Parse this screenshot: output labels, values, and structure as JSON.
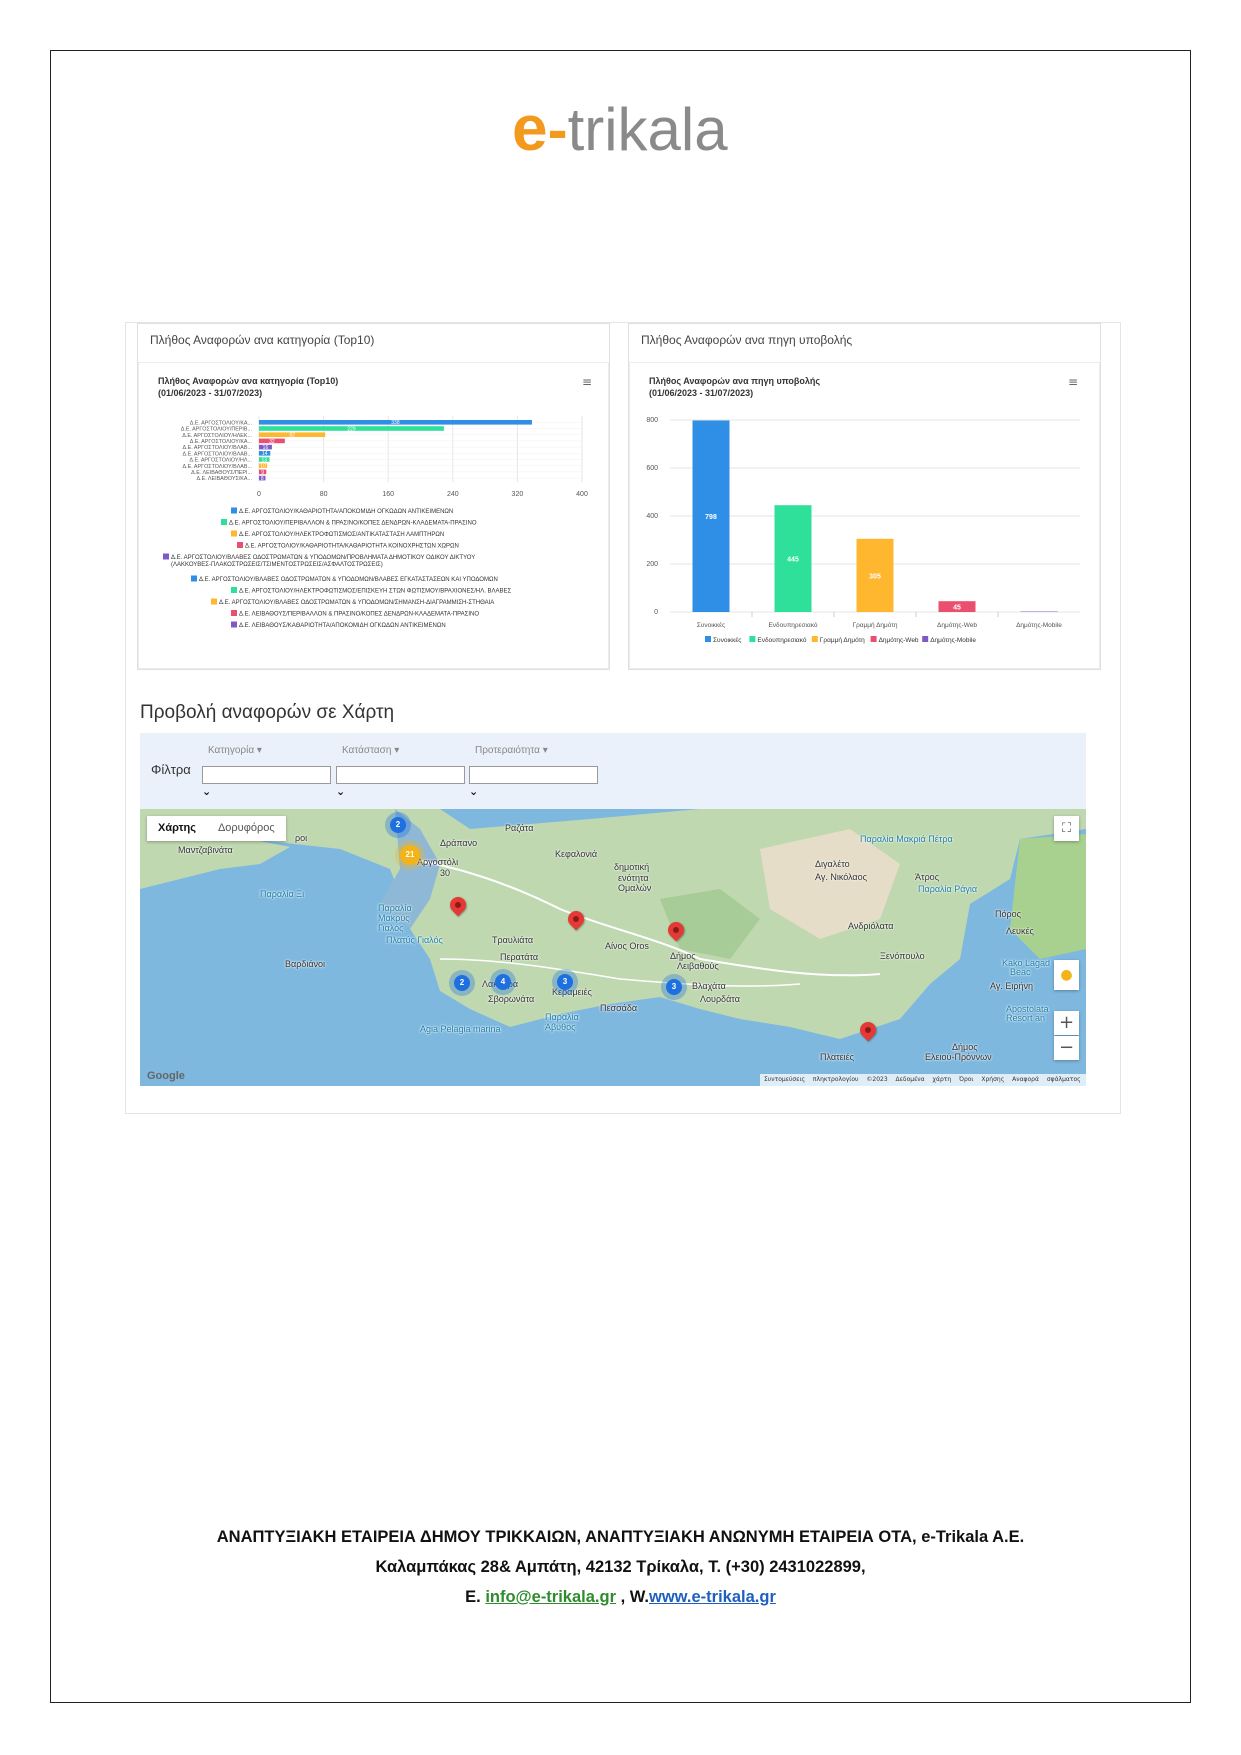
{
  "logo": {
    "e": "e",
    "dash": "-",
    "rest": "trikala"
  },
  "panels": {
    "category": {
      "header": "Πλήθος Αναφορών ανα κατηγορία (Top10)",
      "chart_title": "Πλήθος Αναφορών ανα κατηγορία (Top10)",
      "chart_subtitle": "(01/06/2023 - 31/07/2023)"
    },
    "source": {
      "header": "Πλήθος Αναφορών ανα πηγη υποβολής",
      "chart_title": "Πλήθος Αναφορών ανα πηγη υποβολής",
      "chart_subtitle": "(01/06/2023 - 31/07/2023)"
    }
  },
  "chart_data": [
    {
      "type": "bar",
      "orientation": "horizontal",
      "title": "Πλήθος Αναφορών ανα κατηγορία (Top10)",
      "subtitle": "(01/06/2023 - 31/07/2023)",
      "xlim": [
        0,
        400
      ],
      "xticks": [
        0,
        80,
        160,
        240,
        320,
        400
      ],
      "grid": true,
      "legend": "bottom",
      "categories": [
        "Δ.Ε. ΑΡΓΟΣΤΟΛΙΟΥ/ΚΑ...",
        "Δ.Ε. ΑΡΓΟΣΤΟΛΙΟΥ/ΠΕΡΙΒ...",
        "Δ.Ε. ΑΡΓΟΣΤΟΛΙΟΥ/ΗΛΕΚ...",
        "Δ.Ε. ΑΡΓΟΣΤΟΛΙΟΥ/ΚΑ...",
        "Δ.Ε. ΑΡΓΟΣΤΟΛΙΟΥ/ΒΛΑΒ...",
        "Δ.Ε. ΑΡΓΟΣΤΟΛΙΟΥ/ΒΛΑΒ...",
        "Δ.Ε. ΑΡΓΟΣΤΟΛΙΟΥ/ΗΛ...",
        "Δ.Ε. ΑΡΓΟΣΤΟΛΙΟΥ/ΒΛΑΒ...",
        "Δ.Ε. ΛΕΙΒΑΘΟΥΣ/ΠΕΡΙ...",
        "Δ.Ε. ΛΕΙΒΑΘΟΥΣ/ΚΑ..."
      ],
      "values": [
        338,
        229,
        82,
        32,
        16,
        14,
        13,
        10,
        9,
        8
      ],
      "colors": [
        "#2f8ee5",
        "#2ee09a",
        "#ffb730",
        "#ea4f6f",
        "#7d5bc6",
        "#2f8ee5",
        "#2ee09a",
        "#ffb730",
        "#ea4f6f",
        "#7d5bc6"
      ],
      "legend_entries": [
        "Δ.Ε. ΑΡΓΟΣΤΟΛΙΟΥ/ΚΑΘΑΡΙΟΤΗΤΑ/ΑΠΟΚΟΜΙΔΗ ΟΓΚΩΔΩΝ ΑΝΤΙΚΕΙΜΕΝΩΝ",
        "Δ.Ε. ΑΡΓΟΣΤΟΛΙΟΥ/ΠΕΡΙΒΑΛΛΟΝ & ΠΡΑΣΙΝΟ/ΚΟΠΕΣ ΔΕΝΔΡΩΝ-ΚΛΑΔΕΜΑΤΑ-ΠΡΑΣΙΝΟ",
        "Δ.Ε. ΑΡΓΟΣΤΟΛΙΟΥ/ΗΛΕΚΤΡΟΦΩΤΙΣΜΟΣ/ΑΝΤΙΚΑΤΑΣΤΑΣΗ ΛΑΜΠΤΗΡΩΝ",
        "Δ.Ε. ΑΡΓΟΣΤΟΛΙΟΥ/ΚΑΘΑΡΙΟΤΗΤΑ/ΚΑΘΑΡΙΟΤΗΤΑ ΚΟΙΝΟΧΡΗΣΤΩΝ ΧΩΡΩΝ",
        "Δ.Ε. ΑΡΓΟΣΤΟΛΙΟΥ/ΒΛΑΒΕΣ ΟΔΟΣΤΡΩΜΑΤΩΝ & ΥΠΟΔΟΜΩΝ/ΠΡΟΒΛΗΜΑΤΑ ΔΗΜΟΤΙΚΟΥ ΟΔΙΚΟΥ ΔΙΚΤΥΟΥ (ΛΑΚΚΟΥΒΕΣ-ΠΛΑΚΟΣΤΡΩΣΕΙΣ/ΤΣΙΜΕΝΤΟΣΤΡΩΣΕΙΣ/ΑΣΦΑΛΤΟΣΤΡΩΣΕΙΣ)",
        "Δ.Ε. ΑΡΓΟΣΤΟΛΙΟΥ/ΒΛΑΒΕΣ ΟΔΟΣΤΡΩΜΑΤΩΝ & ΥΠΟΔΟΜΩΝ/ΒΛΑΒΕΣ ΕΓΚΑΤΑΣΤΑΣΕΩΝ ΚΑΙ ΥΠΟΔΟΜΩΝ",
        "Δ.Ε. ΑΡΓΟΣΤΟΛΙΟΥ/ΗΛΕΚΤΡΟΦΩΤΙΣΜΟΣ/ΕΠΙΣΚΕΥΗ ΣΤΩΝ ΦΩΤΙΣΜΟΥ/ΒΡΑΧΙΟΝΕΣ/ΗΛ. ΒΛΑΒΕΣ",
        "Δ.Ε. ΑΡΓΟΣΤΟΛΙΟΥ/ΒΛΑΒΕΣ ΟΔΟΣΤΡΩΜΑΤΩΝ & ΥΠΟΔΟΜΩΝ/ΣΗΜΑΝΣΗ-ΔΙΑΓΡΑΜΜΙΣΗ-ΣΤΗΘΑΙΑ",
        "Δ.Ε. ΛΕΙΒΑΘΟΥΣ/ΠΕΡΙΒΑΛΛΟΝ & ΠΡΑΣΙΝΟ/ΚΟΠΕΣ ΔΕΝΔΡΩΝ-ΚΛΑΔΕΜΑΤΑ-ΠΡΑΣΙΝΟ",
        "Δ.Ε. ΛΕΙΒΑΘΟΥΣ/ΚΑΘΑΡΙΟΤΗΤΑ/ΑΠΟΚΟΜΙΔΗ ΟΓΚΩΔΩΝ ΑΝΤΙΚΕΙΜΕΝΩΝ"
      ]
    },
    {
      "type": "bar",
      "orientation": "vertical",
      "title": "Πλήθος Αναφορών ανα πηγη υποβολής",
      "subtitle": "(01/06/2023 - 31/07/2023)",
      "ylim": [
        0,
        800
      ],
      "yticks": [
        0,
        200,
        400,
        600,
        800
      ],
      "grid": true,
      "legend": "bottom",
      "categories": [
        "Συνοικκές",
        "Ενδουπηρεσιακό",
        "Γραμμή Δημότη",
        "Δημότης-Web",
        "Δημότης-Mobile"
      ],
      "values": [
        798,
        445,
        305,
        45,
        2
      ],
      "value_labels": [
        "798",
        "445",
        "305",
        "45",
        ""
      ],
      "colors": [
        "#2f8ee5",
        "#2ee09a",
        "#ffb730",
        "#ea4f6f",
        "#7d5bc6"
      ]
    }
  ],
  "map_section": {
    "title": "Προβολή αναφορών σε Χάρτη",
    "filters_label": "Φίλτρα",
    "filters": [
      {
        "label": "Κατηγορία ▾",
        "value": ""
      },
      {
        "label": "Κατάσταση ▾",
        "value": ""
      },
      {
        "label": "Προτεραιότητα ▾",
        "value": ""
      }
    ],
    "chevron": "⌄",
    "toggle": {
      "map": "Χάρτης",
      "satellite": "Δορυφόρος"
    },
    "places": [
      {
        "name": "Ραζάτα"
      },
      {
        "name": "Δράπανο"
      },
      {
        "name": "Αργοστόλι"
      },
      {
        "name": "Κεφαλονιά"
      },
      {
        "name": "δημοτική"
      },
      {
        "name": "ενότητα"
      },
      {
        "name": "Ομαλών"
      },
      {
        "name": "Παραλία Μακριά Πέτρα"
      },
      {
        "name": "Διγαλέτο"
      },
      {
        "name": "Αγ. Νικόλαος"
      },
      {
        "name": "Άτρος"
      },
      {
        "name": "Παραλία Ράγια"
      },
      {
        "name": "Πόρος"
      },
      {
        "name": "Λευκές"
      },
      {
        "name": "Ανδριόλατα"
      },
      {
        "name": "Ξενόπουλο"
      },
      {
        "name": "Kako Lagad"
      },
      {
        "name": "Beac"
      },
      {
        "name": "Αγ. Ειρήνη"
      },
      {
        "name": "Apostolata"
      },
      {
        "name": "Resort an"
      },
      {
        "name": "Δήμος"
      },
      {
        "name": "Ελειού-Πρόννων"
      },
      {
        "name": "Πλατειές"
      },
      {
        "name": "Αίνος Oros"
      },
      {
        "name": "Τραυλιάτα"
      },
      {
        "name": "Περατάτα"
      },
      {
        "name": "Δήμος"
      },
      {
        "name": "Λειβαθούς"
      },
      {
        "name": "Βλαχάτα"
      },
      {
        "name": "Λουρδάτα"
      },
      {
        "name": "Λακήθρα"
      },
      {
        "name": "Σβορωνάτα"
      },
      {
        "name": "Κεραμειές"
      },
      {
        "name": "Πεσσάδα"
      },
      {
        "name": "Παραλία"
      },
      {
        "name": "Άβυθος"
      },
      {
        "name": "Agia Pelagia marina"
      },
      {
        "name": "Παραλία"
      },
      {
        "name": "Μακρύς"
      },
      {
        "name": "Γιαλός"
      },
      {
        "name": "Πλατύς Γιαλός"
      },
      {
        "name": "Βαρδιάνοι"
      },
      {
        "name": "Παραλία Ξι"
      },
      {
        "name": "Μαντζαβινάτα"
      },
      {
        "name": "ροι"
      },
      {
        "name": "30"
      }
    ],
    "clusters": [
      {
        "count": "2",
        "color": "#1e6fe0"
      },
      {
        "count": "21",
        "color": "#f2b418"
      },
      {
        "count": "2",
        "color": "#1e6fe0"
      },
      {
        "count": "4",
        "color": "#1e6fe0"
      },
      {
        "count": "3",
        "color": "#1e6fe0"
      },
      {
        "count": "3",
        "color": "#1e6fe0"
      }
    ],
    "attribution": "Συντομεύσεις πληκτρολογίου ©2023 Δεδομένα χάρτη Όροι Χρήσης Αναφορά σφάλματος χάρτη",
    "google": "Google",
    "fullscreen": "⛶",
    "zoom_in": "+",
    "zoom_out": "−"
  },
  "footer": {
    "line1": "ΑΝΑΠΤΥΞΙΑΚΗ ΕΤΑΙΡΕΙΑ ΔΗΜΟΥ ΤΡΙΚΚΑΙΩΝ, ΑΝΑΠΤΥΞΙΑΚΗ ΑΝΩΝΥΜΗ ΕΤΑΙΡΕΙΑ ΟΤΑ,  e-Trikala A.E.",
    "line2": "Καλαμπάκας 28& Αμπάτη, 42132 Τρίκαλα, Τ. (+30) 2431022899,",
    "email_prefix": "Ε. ",
    "email": "info@e-trikala.gr",
    "sep": " , W.",
    "web": "www.e-trikala.gr"
  }
}
